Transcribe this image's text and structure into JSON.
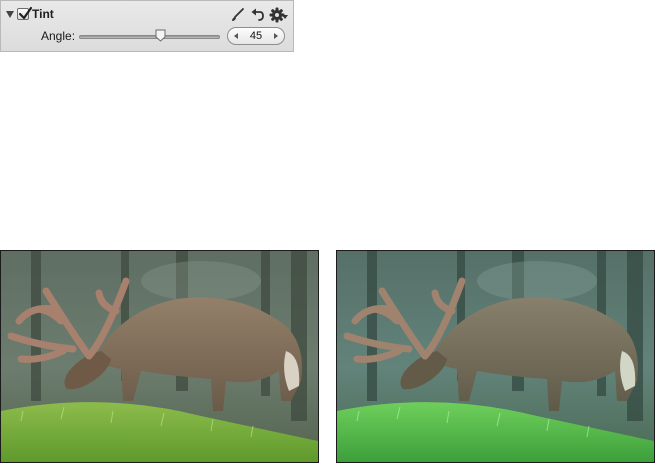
{
  "panel": {
    "title": "Tint",
    "checked": true,
    "expanded": true,
    "icons": [
      "disclosure-triangle-icon",
      "checkbox-icon",
      "brush-icon",
      "undo-icon",
      "gear-icon"
    ]
  },
  "angle": {
    "label": "Angle:",
    "value": "45",
    "slider_fraction": 0.58
  },
  "photos": [
    {
      "name": "original",
      "tint": "neutral"
    },
    {
      "name": "tinted",
      "tint": "green-cyan"
    }
  ],
  "colors": {
    "panel_bg": "#e2e2e2",
    "border": "#b9b9b9",
    "photo_border": "#1b1b1b"
  }
}
